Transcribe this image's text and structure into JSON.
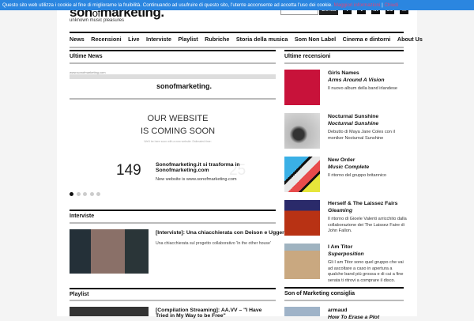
{
  "cookie": {
    "text": "Questo sito web utilizza i cookie al fine di migliorarne la fruibilità. Continuando ad usufruire di questo sito, l'utente acconsente ad accetta l'uso dei cookie.",
    "more": "Maggiori informazioni",
    "sep": "|",
    "close": "Chiudi"
  },
  "header": {
    "logo_a": "son",
    "logo_b": "of",
    "logo_c": "marketing.",
    "tagline": "unknown music pleasures",
    "search_button": "Cerca",
    "social": [
      "f",
      "t",
      "in",
      "sc",
      "✉"
    ]
  },
  "nav": [
    "News",
    "Recensioni",
    "Live",
    "Interviste",
    "Playlist",
    "Rubriche",
    "Storia della musica",
    "Som Non Label",
    "Cinema e dintorni",
    "About Us"
  ],
  "news": {
    "title": "Ultime News",
    "url": "www.sonofmarketing.com",
    "logo": "sonofmarketing.",
    "tagline": "unknown music pleasures",
    "coming1": "OUR WEBSITE",
    "coming2": "IS COMING SOON",
    "coming_sub": "We'll be here soon with a new website. Estimated time:",
    "days": "149",
    "days_faded": "25",
    "headline": "Sonofmarketing.it si trasforma in Sonofmarketing.com",
    "excerpt": "New website is www.sonofmarketing.com",
    "slides": 5,
    "active_slide": 1
  },
  "interviste": {
    "title": "Interviste",
    "headline": "[Interviste]: Una chiacchierata con Deison e Uggeri",
    "excerpt": "Una chiacchierata sul progetto collaborativo 'In the other house'"
  },
  "playlist": {
    "title": "Playlist",
    "headline": "[Compilation Streaming]: AA.VV – \"I Have Tried in My Way to be Free\""
  },
  "reviews": {
    "title": "Ultime recensioni",
    "items": [
      {
        "artist": "Girls Names",
        "album": "Arms Around A Vision",
        "desc": "Il nuovo album della band irlandese"
      },
      {
        "artist": "Nocturnal Sunshine",
        "album": "Nocturnal Sunshine",
        "desc": "Debutto di Maya Jane Coles con il moniker Nocturnal Sunshine"
      },
      {
        "artist": "New Order",
        "album": "Music Complete",
        "desc": "Il ritorno del gruppo britannico"
      },
      {
        "artist": "Herself & The Laissez Fairs",
        "album": "Gleaming",
        "desc": "Il ritorno di Gioele Valenti arricchito dalla collaborazione dei The Laissez Faire di John Fallon."
      },
      {
        "artist": "I Am Titor",
        "album": "Superposition",
        "desc": "Gli I am Titor sono quel gruppo che vai ad ascoltare a caso in apertura a qualche band più grossa e di cui a fine serata ti ritrovi a comprare il disco."
      }
    ]
  },
  "consiglia": {
    "title": "Son of Marketing consiglia",
    "artist": "armaud",
    "album": "How To Erase a Plot"
  }
}
